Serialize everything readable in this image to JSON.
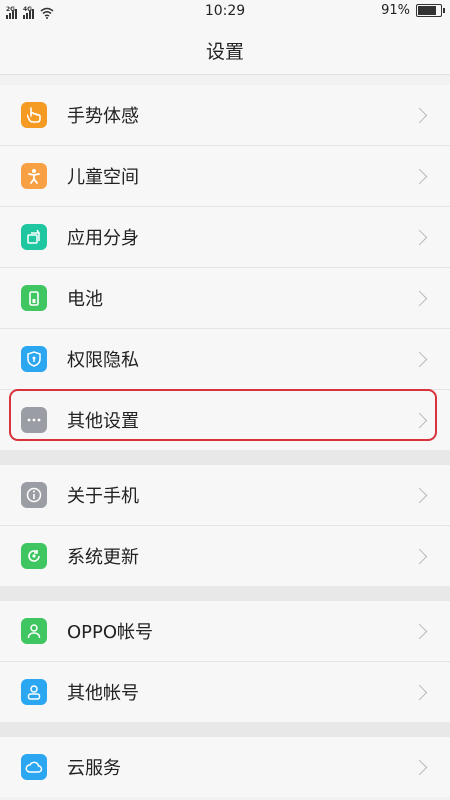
{
  "status_bar": {
    "network_1": "2G",
    "network_2": "4G",
    "time": "10:29",
    "battery_percent": "91%",
    "battery_level": 0.91
  },
  "header": {
    "title": "设置"
  },
  "groups": [
    {
      "items": [
        {
          "name": "gesture",
          "label": "手势体感",
          "icon": "hand-gesture-icon",
          "color": "#f59a23"
        },
        {
          "name": "kids-space",
          "label": "儿童空间",
          "icon": "child-icon",
          "color": "#f7a144"
        },
        {
          "name": "app-clone",
          "label": "应用分身",
          "icon": "app-clone-icon",
          "color": "#1ec7a0"
        },
        {
          "name": "battery",
          "label": "电池",
          "icon": "battery-icon",
          "color": "#3fc660"
        },
        {
          "name": "privacy",
          "label": "权限隐私",
          "icon": "shield-icon",
          "color": "#2aa7f0"
        },
        {
          "name": "other-settings",
          "label": "其他设置",
          "icon": "more-icon",
          "color": "#9a9da3"
        }
      ]
    },
    {
      "items": [
        {
          "name": "about-phone",
          "label": "关于手机",
          "icon": "info-icon",
          "color": "#9a9da3"
        },
        {
          "name": "system-update",
          "label": "系统更新",
          "icon": "update-icon",
          "color": "#3fc660"
        }
      ]
    },
    {
      "items": [
        {
          "name": "oppo-account",
          "label": "OPPO帐号",
          "icon": "user-icon",
          "color": "#3fc660"
        },
        {
          "name": "other-accounts",
          "label": "其他帐号",
          "icon": "account-icon",
          "color": "#2aa7f0"
        }
      ]
    },
    {
      "items": [
        {
          "name": "cloud-service",
          "label": "云服务",
          "icon": "cloud-icon",
          "color": "#2aa7f0"
        }
      ]
    }
  ],
  "highlight": {
    "target": "other-settings",
    "color": "#d8323b"
  }
}
